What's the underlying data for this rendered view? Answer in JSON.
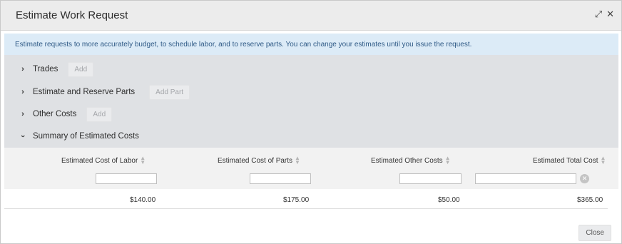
{
  "dialog": {
    "title": "Estimate Work Request"
  },
  "info_text": "Estimate requests to more accurately budget, to schedule labor, and to reserve parts. You can change your estimates until you issue the request.",
  "sections": [
    {
      "label": "Trades",
      "button": "Add",
      "expanded": false
    },
    {
      "label": "Estimate and Reserve Parts",
      "button": "Add Part",
      "expanded": false
    },
    {
      "label": "Other Costs",
      "button": "Add",
      "expanded": false
    },
    {
      "label": "Summary of Estimated Costs",
      "expanded": true
    }
  ],
  "summary": {
    "columns": [
      "Estimated Cost of Labor",
      "Estimated Cost of Parts",
      "Estimated Other Costs",
      "Estimated Total Cost"
    ],
    "row": [
      "$140.00",
      "$175.00",
      "$50.00",
      "$365.00"
    ]
  },
  "footer": {
    "close_label": "Close"
  }
}
